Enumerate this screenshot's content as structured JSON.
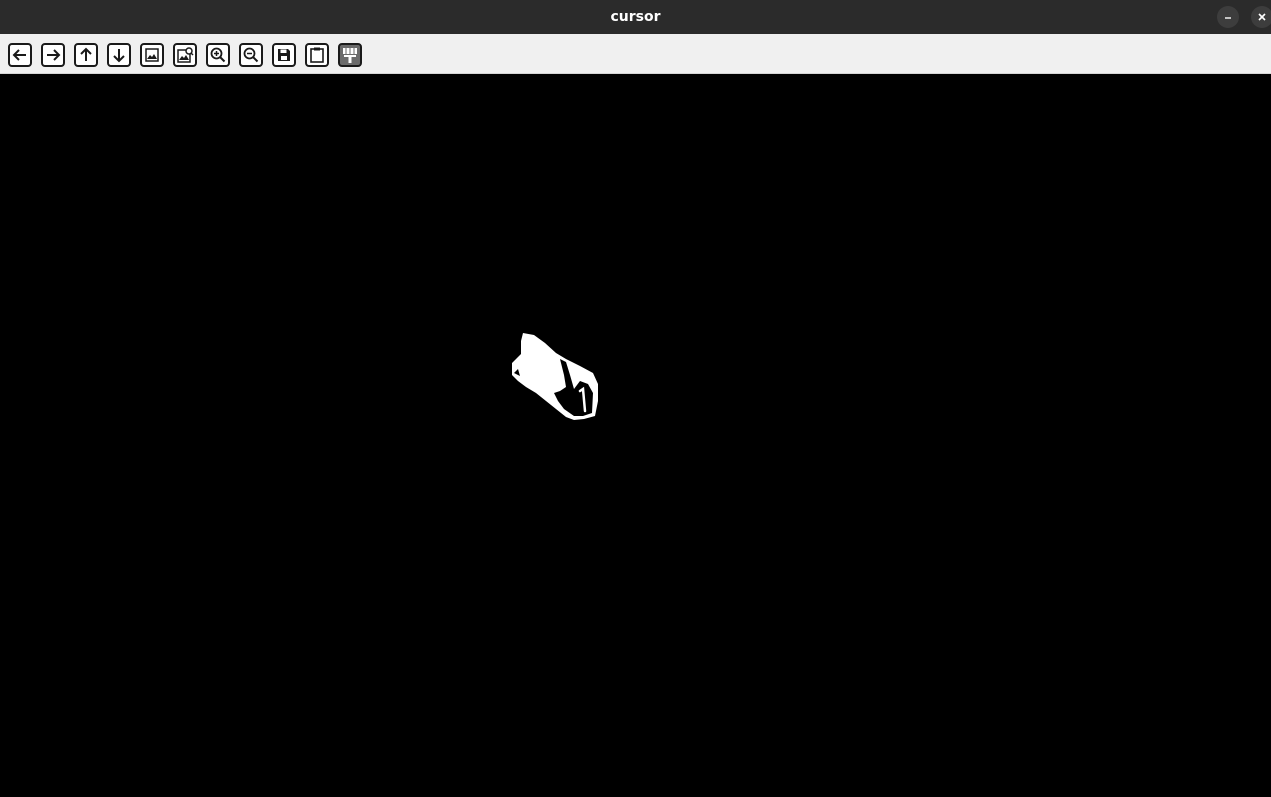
{
  "window": {
    "title": "cursor",
    "controls": {
      "minimize_icon": "minimize-icon",
      "close_icon": "close-icon"
    }
  },
  "toolbar": {
    "tools": [
      {
        "name": "back",
        "icon": "arrow-left-icon"
      },
      {
        "name": "forward",
        "icon": "arrow-right-icon"
      },
      {
        "name": "up",
        "icon": "arrow-up-icon"
      },
      {
        "name": "down",
        "icon": "arrow-down-icon"
      },
      {
        "name": "image",
        "icon": "image-icon"
      },
      {
        "name": "image-search",
        "icon": "image-search-icon"
      },
      {
        "name": "zoom-in",
        "icon": "zoom-in-icon"
      },
      {
        "name": "zoom-out",
        "icon": "zoom-out-icon"
      },
      {
        "name": "save",
        "icon": "save-icon"
      },
      {
        "name": "clipboard",
        "icon": "clipboard-icon"
      },
      {
        "name": "paint",
        "icon": "paint-roller-icon"
      }
    ]
  },
  "canvas": {
    "background": "#000000",
    "content": "hand-pointer-cursor-image"
  },
  "colors": {
    "titlebar": "#2b2b2b",
    "toolbar": "#f0f0f0",
    "icon": "#1a1a1a",
    "cursor_fill": "#ffffff"
  }
}
